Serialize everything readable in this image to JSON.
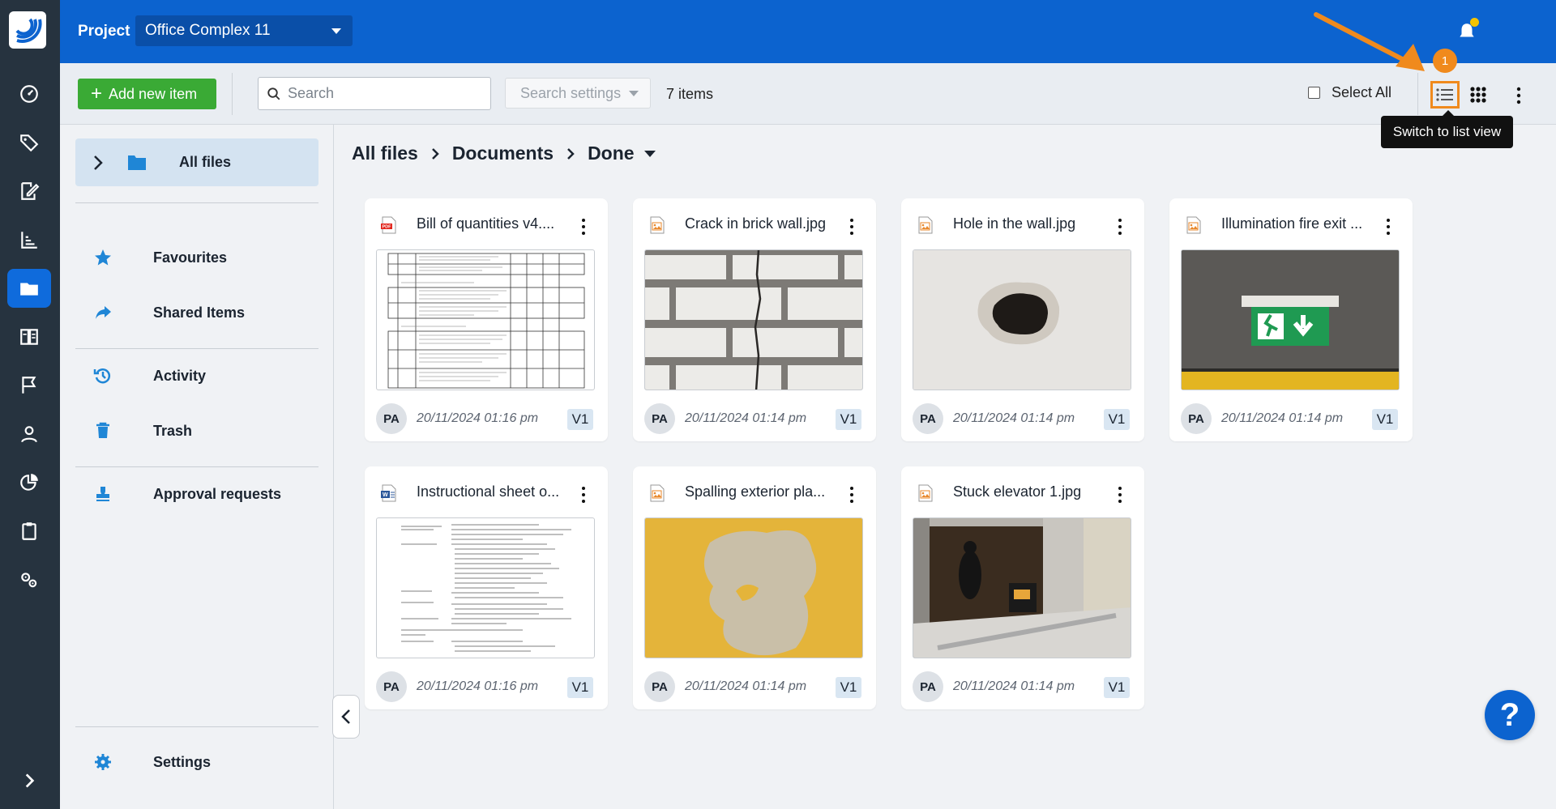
{
  "topbar": {
    "project_label": "Project",
    "project_name": "Office Complex 11"
  },
  "toolbar": {
    "add_label": "Add new item",
    "search_placeholder": "Search",
    "search_settings_label": "Search settings",
    "items_count": "7 items",
    "select_all_label": "Select All",
    "annotation_badge": "1",
    "tooltip": "Switch to list view"
  },
  "rail": {
    "icons": [
      "dashboard-icon",
      "tag-icon",
      "edit-doc-icon",
      "chart-icon",
      "folder-icon",
      "book-icon",
      "flag-icon",
      "user-icon",
      "pie-chart-icon",
      "clipboard-icon",
      "settings-gears-icon",
      "expand-chevron-icon"
    ],
    "active": "folder-icon"
  },
  "sidebar": {
    "all_files": "All files",
    "items": [
      {
        "label": "Favourites",
        "icon": "star-icon"
      },
      {
        "label": "Shared Items",
        "icon": "share-icon"
      },
      {
        "label": "Activity",
        "icon": "history-icon"
      },
      {
        "label": "Trash",
        "icon": "trash-icon"
      },
      {
        "label": "Approval requests",
        "icon": "stamp-icon"
      }
    ],
    "settings": "Settings"
  },
  "breadcrumb": {
    "items": [
      "All files",
      "Documents",
      "Done"
    ]
  },
  "files": [
    {
      "title": "Bill of quantities v4....",
      "type": "pdf",
      "avatar": "PA",
      "date": "20/11/2024 01:16 pm",
      "version": "V1"
    },
    {
      "title": "Crack in brick wall.jpg",
      "type": "image",
      "avatar": "PA",
      "date": "20/11/2024 01:14 pm",
      "version": "V1"
    },
    {
      "title": "Hole in the wall.jpg",
      "type": "image",
      "avatar": "PA",
      "date": "20/11/2024 01:14 pm",
      "version": "V1"
    },
    {
      "title": "Illumination fire exit ...",
      "type": "image",
      "avatar": "PA",
      "date": "20/11/2024 01:14 pm",
      "version": "V1"
    },
    {
      "title": "Instructional sheet o...",
      "type": "word",
      "avatar": "PA",
      "date": "20/11/2024 01:16 pm",
      "version": "V1"
    },
    {
      "title": "Spalling exterior pla...",
      "type": "image",
      "avatar": "PA",
      "date": "20/11/2024 01:14 pm",
      "version": "V1"
    },
    {
      "title": "Stuck elevator 1.jpg",
      "type": "image",
      "avatar": "PA",
      "date": "20/11/2024 01:14 pm",
      "version": "V1"
    }
  ],
  "help": "?",
  "colors": {
    "brand_blue": "#0c63cf",
    "rail": "#26333f",
    "add_green": "#3aaa35",
    "annotation_orange": "#f08a1d"
  }
}
